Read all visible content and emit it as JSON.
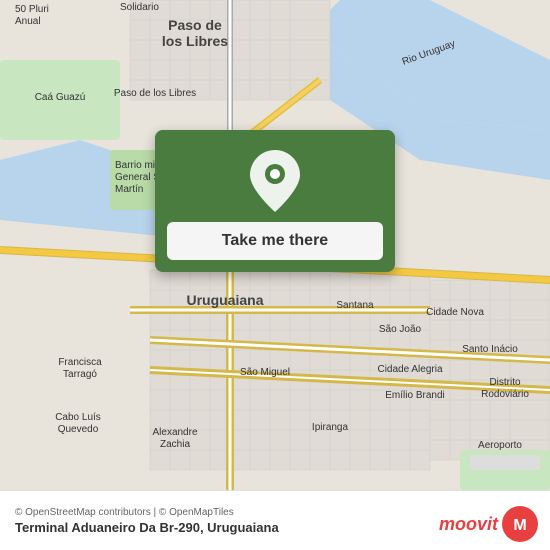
{
  "map": {
    "attribution": "© OpenStreetMap contributors | © OpenMapTiles",
    "center_city": "Uruguaiana",
    "nearby_cities": [
      "Paso de los Libres",
      "Santana",
      "São João",
      "Cidade Nova",
      "Santo Inácio",
      "Barrio mil General San Martín",
      "Francisca Tarragó",
      "São Miguel",
      "Cidade Alegria",
      "Emílio Brandi",
      "Distrito Rodoviário",
      "Caá Guazú",
      "Cabo Luís Quevedo",
      "Alexandre Zachia",
      "Ipiranga"
    ],
    "river": "Rio Uruguay",
    "accent_color": "#4a7c3f",
    "water_color": "#b8d4ec",
    "road_yellow": "#f5c842"
  },
  "popup": {
    "button_label": "Take me there",
    "pin_color": "#ffffff"
  },
  "footer": {
    "attribution": "© OpenStreetMap contributors | © OpenMapTiles",
    "location_name": "Terminal Aduaneiro Da Br-290, Uruguaiana",
    "moovit_label": "moovit"
  }
}
